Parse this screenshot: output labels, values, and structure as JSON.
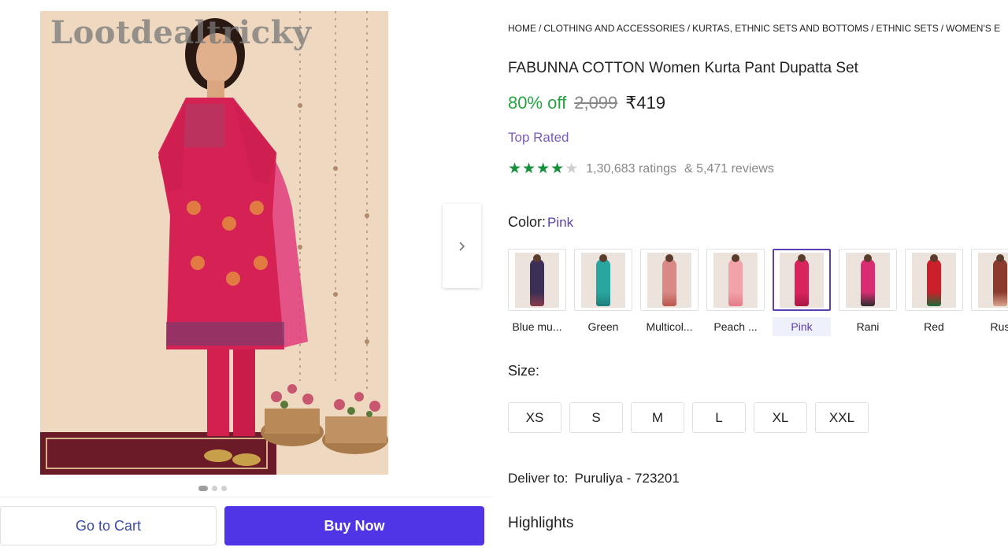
{
  "product_image": {
    "watermark": "Lootdealtricky",
    "next_icon": "chevron-right-icon",
    "dots_total": 3,
    "dots_active": 1
  },
  "actions": {
    "go_to_cart": "Go to Cart",
    "buy_now": "Buy Now",
    "accent": "#5035e6"
  },
  "breadcrumb": [
    "HOME",
    "CLOTHING AND ACCESSORIES",
    "KURTAS, ETHNIC SETS AND BOTTOMS",
    "ETHNIC SETS",
    "WOMEN'S E"
  ],
  "product": {
    "title": "FABUNNA COTTON Women Kurta Pant Dupatta Set",
    "discount": "80% off",
    "mrp": "2,099",
    "price": "₹419",
    "badge": "Top Rated",
    "rating_stars": 4,
    "rating_max": 5,
    "ratings": "1,30,683 ratings",
    "reviews": "& 5,471 reviews"
  },
  "color": {
    "label": "Color:",
    "selected": "Pink",
    "options": [
      {
        "name": "Blue mu...",
        "tone": "#3b2f55",
        "accent": "#8a3b4c"
      },
      {
        "name": "Green",
        "tone": "#2aa6a0",
        "accent": "#1c7f7a"
      },
      {
        "name": "Multicol...",
        "tone": "#d98a86",
        "accent": "#b9574f"
      },
      {
        "name": "Peach ...",
        "tone": "#f2a2a9",
        "accent": "#e47b88"
      },
      {
        "name": "Pink",
        "tone": "#d8245c",
        "accent": "#a81645",
        "selected": true
      },
      {
        "name": "Rani",
        "tone": "#d82d73",
        "accent": "#2d2d2d"
      },
      {
        "name": "Red",
        "tone": "#c9202a",
        "accent": "#1e6b3a"
      },
      {
        "name": "Rus",
        "tone": "#8c3a2e",
        "accent": "#d9a58e"
      }
    ]
  },
  "size": {
    "label": "Size:",
    "options": [
      "XS",
      "S",
      "M",
      "L",
      "XL",
      "XXL"
    ]
  },
  "delivery": {
    "label": "Deliver to:",
    "location": "Puruliya - 723201"
  },
  "highlights": {
    "label": "Highlights"
  }
}
